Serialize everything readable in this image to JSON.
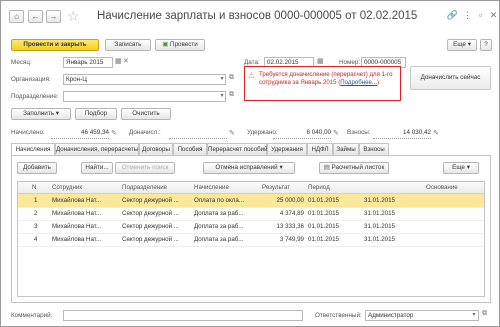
{
  "window": {
    "title": "Начисление зарплаты и взносов 0000-000005 от 02.02.2015"
  },
  "toolbar": {
    "post_close": "Провести и закрыть",
    "save": "Записать",
    "post": "Провести",
    "more": "Еще",
    "help": "?"
  },
  "header": {
    "month_label": "Месяц:",
    "month_value": "Январь 2015",
    "date_label": "Дата:",
    "date_value": "02.02.2015",
    "number_label": "Номер:",
    "number_value": "0000-000005",
    "org_label": "Организация:",
    "org_value": "Крон-Ц",
    "dept_label": "Подразделение:",
    "dept_value": ""
  },
  "warning": {
    "text_line1": "Требуется доначисление (перерасчет) для 1-го",
    "text_line2": "сотрудника за Январь 2015 (",
    "link": "Подробнее...",
    "text_end": ")",
    "button": "Доначислить сейчас"
  },
  "actions": {
    "fill": "Заполнить",
    "select": "Подбор",
    "clear": "Очистить"
  },
  "totals": {
    "accrued_label": "Начислено:",
    "accrued_value": "46 459,34",
    "withheld_label": "Удержано:",
    "withheld_value": "6 040,00",
    "contrib_label": "Взносы:",
    "contrib_value": "14 030,42",
    "deducted_label": "Доначисл.:"
  },
  "tabs": [
    "Начисления",
    "Доначисления, перерасчеты",
    "Договоры",
    "Пособия",
    "Перерасчет пособий",
    "Удержания",
    "НДФЛ",
    "Займы",
    "Взносы"
  ],
  "tab_toolbar": {
    "add": "Добавить",
    "find": "Найти...",
    "cancel_search": "Отменить поиск",
    "cancel_corrections": "Отмена исправлений",
    "payslip": "Расчетный листок",
    "more": "Еще"
  },
  "table": {
    "columns": [
      "N",
      "Сотрудник",
      "Подразделение",
      "Начисление",
      "Результат",
      "Период",
      "",
      "Основание"
    ],
    "rows": [
      [
        "1",
        "Михайлова Нат...",
        "Сектор дежурной ...",
        "Оплата по окла...",
        "25 000,00",
        "01.01.2015",
        "31.01.2015",
        ""
      ],
      [
        "2",
        "Михайлова Нат...",
        "Сектор дежурной ...",
        "Доплата за раб...",
        "4 374,89",
        "01.01.2015",
        "31.01.2015",
        ""
      ],
      [
        "3",
        "Михайлова Нат...",
        "Сектор дежурной ...",
        "Доплата за раб...",
        "13 333,36",
        "01.01.2015",
        "31.01.2015",
        ""
      ],
      [
        "4",
        "Михайлова Нат...",
        "Сектор дежурной ...",
        "Доплата за раб...",
        "3 749,99",
        "01.01.2015",
        "31.01.2015",
        ""
      ]
    ]
  },
  "footer": {
    "comment_label": "Комментарий:",
    "comment_value": "",
    "responsible_label": "Ответственный:",
    "responsible_value": "Администратор"
  },
  "colors": {
    "primary_button": "#f5cf20",
    "selected_row": "#fbe89a",
    "warning_border": "#dd2222",
    "warning_text": "#cc2222"
  }
}
